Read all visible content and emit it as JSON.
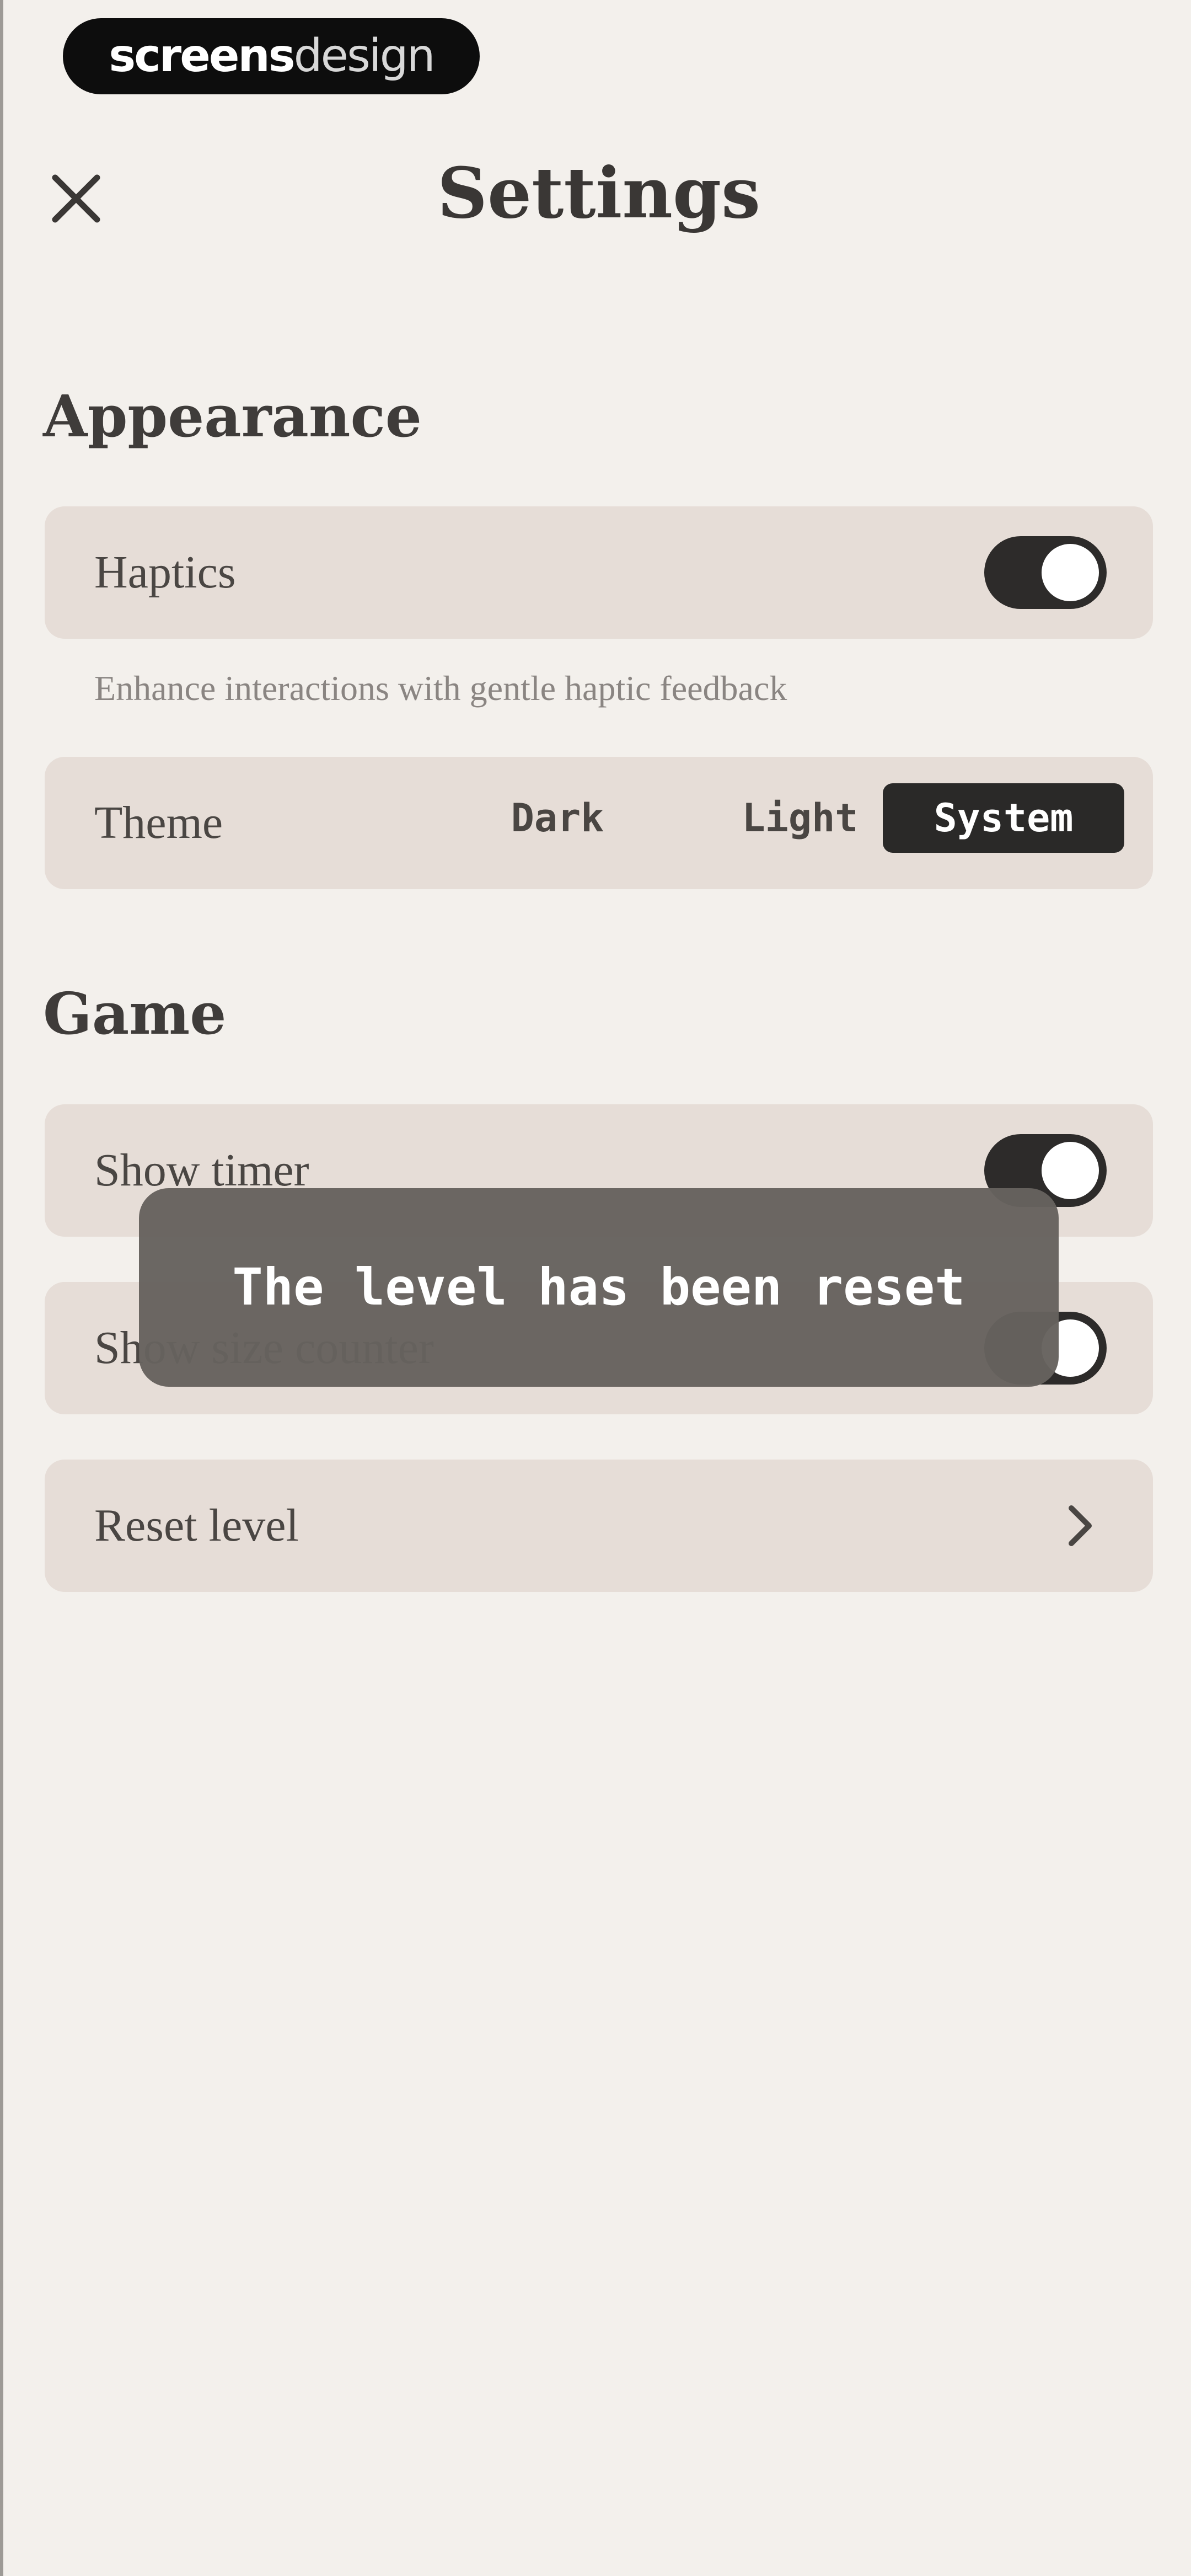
{
  "watermark": {
    "part1": "screens",
    "part2": "design"
  },
  "header": {
    "title": "Settings",
    "close_icon": "close-icon"
  },
  "sections": {
    "appearance": {
      "heading": "Appearance",
      "haptics": {
        "label": "Haptics",
        "enabled": true,
        "helper": "Enhance interactions with gentle haptic feedback"
      },
      "theme": {
        "label": "Theme",
        "options": [
          "Dark",
          "Light",
          "System"
        ],
        "selected": "System"
      }
    },
    "game": {
      "heading": "Game",
      "show_timer": {
        "label": "Show timer",
        "enabled": true
      },
      "show_size_counter": {
        "label": "Show size counter",
        "enabled": true
      },
      "reset_level": {
        "label": "Reset level",
        "icon": "chevron-right-icon"
      }
    }
  },
  "toast": {
    "message": "The level has been reset"
  },
  "colors": {
    "background": "#f3f0ec",
    "row": "#e6ddd7",
    "toggle_on": "#2d2b2a",
    "selected_segment": "#2a2928",
    "toast": "#66625e"
  }
}
